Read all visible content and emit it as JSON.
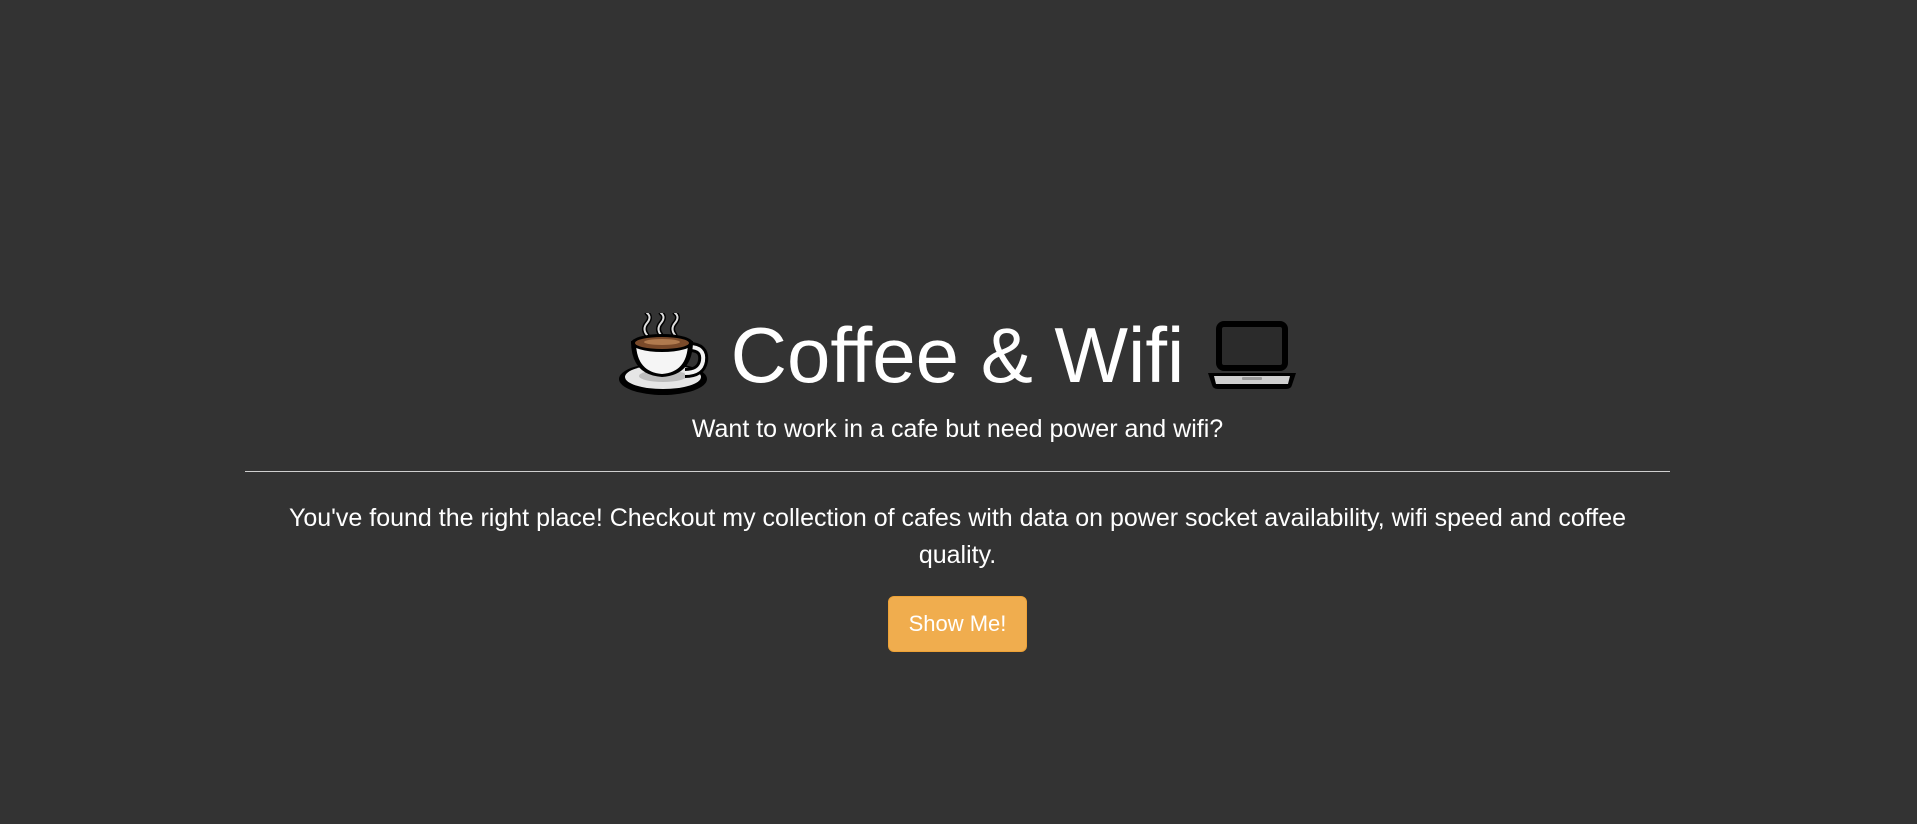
{
  "hero": {
    "title": "Coffee & Wifi",
    "left_icon": "coffee-cup-icon",
    "right_icon": "laptop-icon",
    "subtitle": "Want to work in a cafe but need power and wifi?",
    "description": "You've found the right place! Checkout my collection of cafes with data on power socket availability, wifi speed and coffee quality.",
    "button_label": "Show Me!"
  },
  "colors": {
    "background": "#333333",
    "text": "#ffffff",
    "button": "#f0ad4e"
  }
}
